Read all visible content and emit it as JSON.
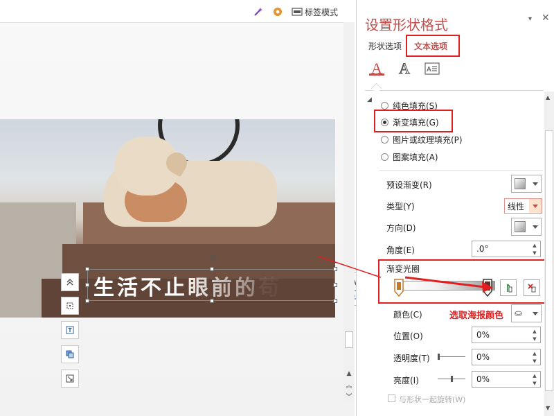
{
  "toolbar": {
    "label_mode": "标签模式",
    "icons": [
      "magic-wand-icon",
      "settings-gear-icon",
      "label-mode-icon"
    ]
  },
  "slide": {
    "text": "生活不止眼前的",
    "text_trailing_faded": "苟",
    "side_tools": [
      "collapse-up-icon",
      "layout-options-icon",
      "text-box-icon",
      "shape-fill-icon",
      "resize-icon"
    ],
    "float_button": "A"
  },
  "panel": {
    "title": "设置形状格式",
    "tabs": [
      {
        "label": "形状选项",
        "active": false
      },
      {
        "label": "文本选项",
        "active": true
      }
    ],
    "type_icons": [
      "text-fill-icon",
      "text-outline-icon",
      "text-box-layout-icon"
    ],
    "fill_options": [
      {
        "label": "纯色填充(S)",
        "selected": false
      },
      {
        "label": "渐变填充(G)",
        "selected": true
      },
      {
        "label": "图片或纹理填充(P)",
        "selected": false
      },
      {
        "label": "图案填充(A)",
        "selected": false
      }
    ],
    "preset_gradient_label": "预设渐变(R)",
    "type_label": "类型(Y)",
    "type_value": "线性",
    "direction_label": "方向(D)",
    "angle_label": "角度(E)",
    "angle_value": ".0°",
    "gradient_stops_label": "渐变光圈",
    "color_label": "颜色(C)",
    "pick_color_hint": "选取海报颜色",
    "position_label": "位置(O)",
    "position_value": "0%",
    "transparency_label": "透明度(T)",
    "transparency_value": "0%",
    "brightness_label": "亮度(I)",
    "brightness_value": "0%",
    "rotate_with_shape_label": "与形状一起旋转(W)"
  },
  "colors": {
    "accent": "#c0504d",
    "highlight": "#e02020",
    "stop_left": "#c8782a",
    "stop_right": "#5a3328"
  }
}
